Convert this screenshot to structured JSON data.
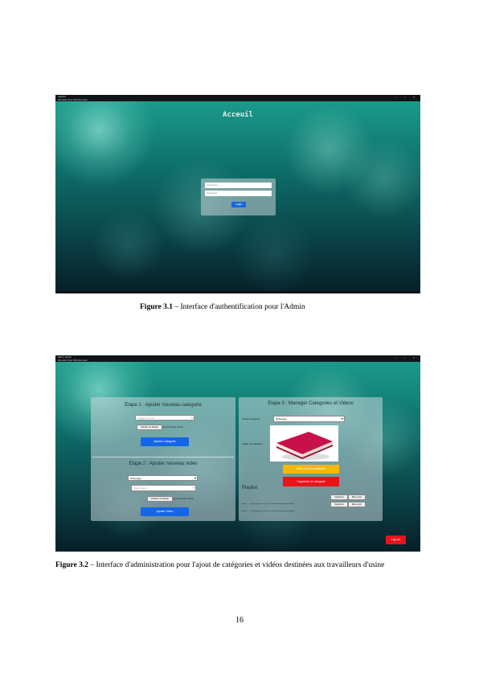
{
  "figure1": {
    "window_title": "JavaFX",
    "menu": "File   Edit   View   Window   Help",
    "controls": "– ▫ ×",
    "heading": "Acceuil",
    "username_placeholder": "Username",
    "password_placeholder": "Password",
    "login_button": "Login",
    "caption_label": "Figure 3.1",
    "caption_text": " – Interface d'authentification pour l'Admin"
  },
  "figure2": {
    "window_title": "Main | admin",
    "menu": "File   Edit   View   Window   Help",
    "controls": "– ▫ ×",
    "step1_title": "Etape 1 : Ajouter nouveau categorie",
    "category_name_placeholder": "Category Name",
    "choose_file": "Choisir un fichier",
    "no_file": "Aucun fichier choisi",
    "add_category_button": "Ajouter Categorie",
    "step2_title": "Etape 2 : Ajouter nouveau video",
    "video_category_selected": "Nettoyage",
    "video_name_placeholder": "Video Name",
    "choose_file2": "Choisir un fichier",
    "no_file2": "Aucun fichier choisi",
    "add_video_button": "Ajouter Video",
    "step3_title": "Etape 3 : Manager Categories et Videos",
    "choose_category_label": "Choisit categorie",
    "manage_category_selected": "Nettoyage",
    "image_label": "Image du categorie",
    "update_category_button": "Mise à jour la catégorie",
    "delete_category_button": "Supprimer la catégorie",
    "playlist_title": "Playlist",
    "playlist": [
      {
        "text": "video 1 : 15 bagul.mp4 (c:\\Users\\PC\\Documents\\workspace\\videos)",
        "delete": "Supprimer",
        "update": "Mise à jour"
      },
      {
        "text": "video 2 : 12 bagul.mp4 (c:\\Users\\PC\\Documents\\workspace\\videos)",
        "delete": "Supprimer",
        "update": "Mise à jour"
      }
    ],
    "logout_button": "Log out",
    "caption_label": "Figure 3.2",
    "caption_text": " – Interface d'administration pour l'ajout de catégories et vidéos destinées aux travailleurs d'usine"
  },
  "page_number": "16"
}
